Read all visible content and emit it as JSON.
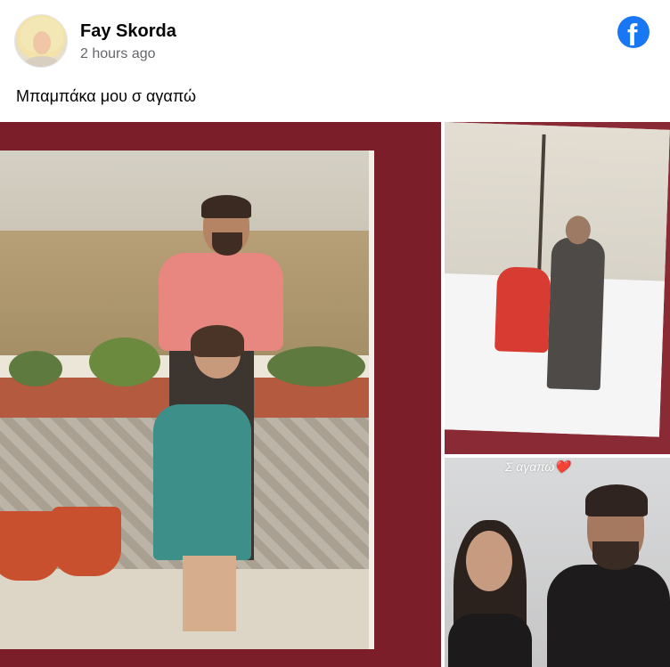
{
  "post": {
    "author": "Fay Skorda",
    "timestamp": "2 hours ago",
    "caption": "Μπαμπάκα μου σ αγαπώ",
    "source_icon": "facebook-logo-icon",
    "source_icon_glyph": "f",
    "brand_color": "#1877f2"
  },
  "photos": {
    "main": {
      "description_icon": "photo-icon"
    },
    "side1": {
      "description_icon": "photo-icon"
    },
    "side2": {
      "overlay_text": "Σ αγαπώ",
      "overlay_emoji": "❤️"
    }
  }
}
